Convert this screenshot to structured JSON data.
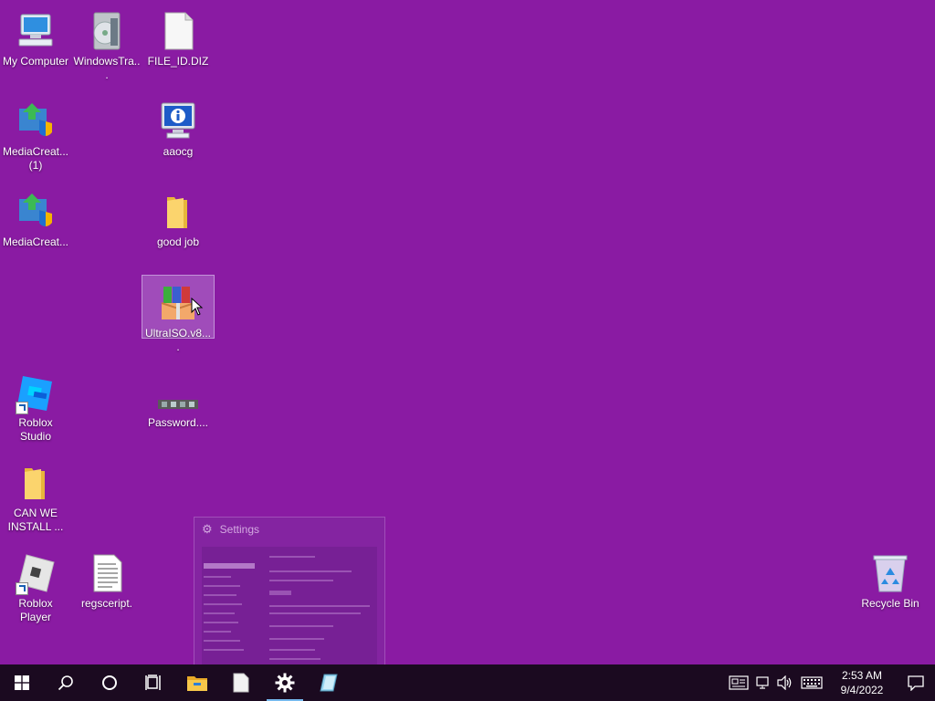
{
  "desktop": {
    "background": "#8a1ba3",
    "icons": [
      {
        "label": "My Computer",
        "icon": "computer-icon"
      },
      {
        "label": "WindowsTra...",
        "icon": "disc-package-icon"
      },
      {
        "label": "FILE_ID.DIZ",
        "icon": "blank-file-icon"
      },
      {
        "label": "MediaCreat... (1)",
        "icon": "media-creation-tool-icon"
      },
      {
        "label": "aaocg",
        "icon": "info-monitor-icon"
      },
      {
        "label": "MediaCreat...",
        "icon": "media-creation-tool-icon"
      },
      {
        "label": "good job",
        "icon": "folder-icon"
      },
      {
        "label": "UltraISO.v8....",
        "icon": "winrar-archive-icon",
        "selected": true
      },
      {
        "label": "Roblox Studio",
        "icon": "roblox-studio-icon",
        "shortcut": true
      },
      {
        "label": "Password....",
        "icon": "password-file-icon"
      },
      {
        "label": "CAN WE INSTALL ...",
        "icon": "folder-icon"
      },
      {
        "label": "Roblox Player",
        "icon": "roblox-player-icon",
        "shortcut": true
      },
      {
        "label": "regsceript.",
        "icon": "text-file-icon"
      },
      {
        "label": "Recycle Bin",
        "icon": "recycle-bin-icon"
      }
    ]
  },
  "settings_preview": {
    "title": "Settings"
  },
  "taskbar": {
    "start": "windows-start-icon",
    "search": "search-icon",
    "cortana": "cortana-circle-icon",
    "task_view": "task-view-icon",
    "pinned": [
      "file-explorer-icon",
      "document-app-icon",
      "settings-gear-icon",
      "notepad-icon"
    ],
    "active_app": "settings-gear-icon",
    "accent": "#76b9ed"
  },
  "tray": {
    "icons": [
      "news-icon",
      "network-icon",
      "volume-icon",
      "keyboard-icon"
    ],
    "time": "2:53 AM",
    "date": "9/4/2022",
    "notification": "action-center-icon"
  }
}
